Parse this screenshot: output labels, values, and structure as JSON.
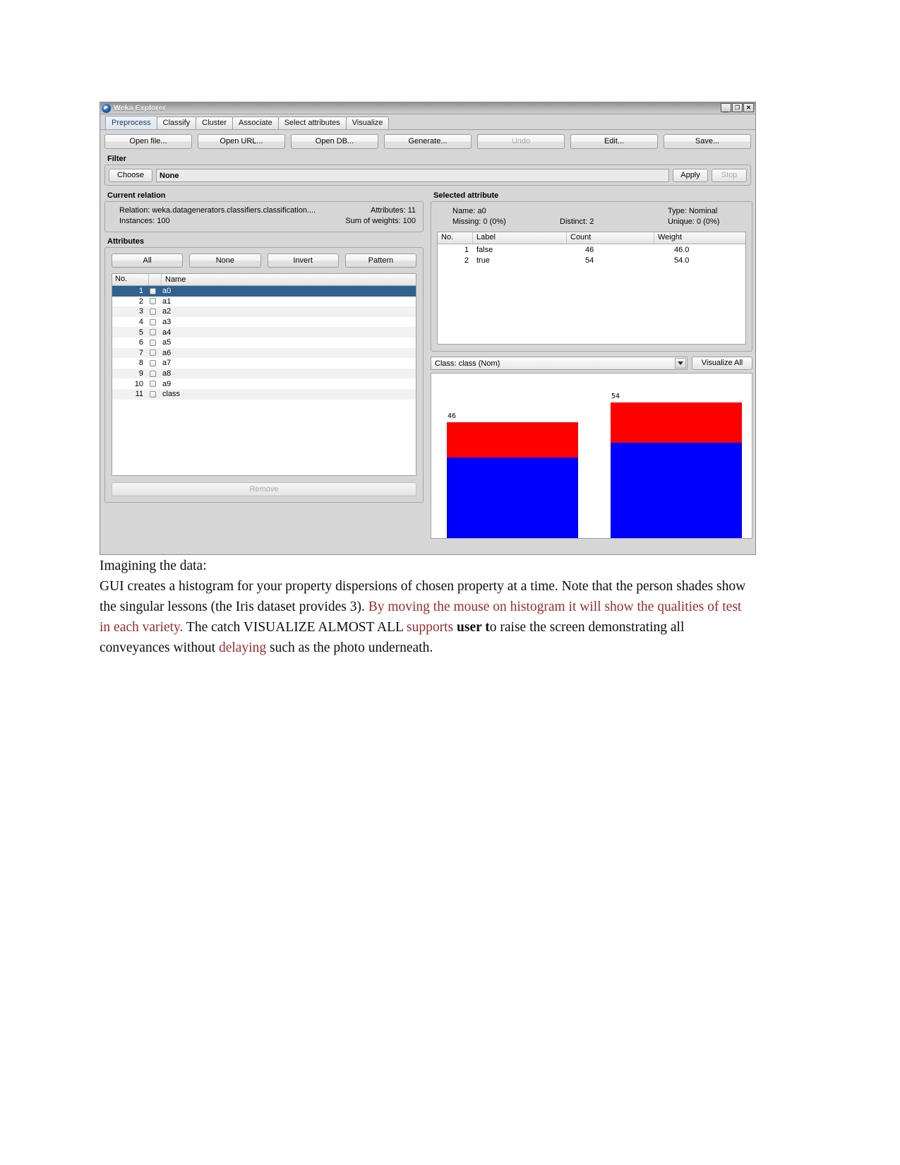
{
  "window": {
    "title": "Weka Explorer",
    "app_icon": "weka-bird-icon",
    "controls": {
      "minimize": "_",
      "maximize": "❐",
      "close": "✕"
    }
  },
  "tabs": [
    {
      "label": "Preprocess",
      "active": true
    },
    {
      "label": "Classify",
      "active": false
    },
    {
      "label": "Cluster",
      "active": false
    },
    {
      "label": "Associate",
      "active": false
    },
    {
      "label": "Select attributes",
      "active": false
    },
    {
      "label": "Visualize",
      "active": false
    }
  ],
  "toolbar": [
    {
      "label": "Open file...",
      "disabled": false
    },
    {
      "label": "Open URL...",
      "disabled": false
    },
    {
      "label": "Open DB...",
      "disabled": false
    },
    {
      "label": "Generate...",
      "disabled": false
    },
    {
      "label": "Undo",
      "disabled": true
    },
    {
      "label": "Edit...",
      "disabled": false
    },
    {
      "label": "Save...",
      "disabled": false
    }
  ],
  "filter": {
    "group_label": "Filter",
    "choose_label": "Choose",
    "value": "None",
    "apply_label": "Apply",
    "stop_label": "Stop",
    "stop_disabled": true
  },
  "current_relation": {
    "group_label": "Current relation",
    "relation_label": "Relation:",
    "relation_value": "weka.datagenerators.classifiers.classification....",
    "attributes_label": "Attributes:",
    "attributes_value": "11",
    "instances_label": "Instances:",
    "instances_value": "100",
    "sum_weights_label": "Sum of weights:",
    "sum_weights_value": "100"
  },
  "attributes": {
    "group_label": "Attributes",
    "buttons": [
      "All",
      "None",
      "Invert",
      "Pattern"
    ],
    "columns": [
      "No.",
      "",
      "Name"
    ],
    "rows": [
      {
        "no": "1",
        "name": "a0",
        "checked": false,
        "selected": true
      },
      {
        "no": "2",
        "name": "a1",
        "checked": false,
        "selected": false
      },
      {
        "no": "3",
        "name": "a2",
        "checked": false,
        "selected": false
      },
      {
        "no": "4",
        "name": "a3",
        "checked": false,
        "selected": false
      },
      {
        "no": "5",
        "name": "a4",
        "checked": false,
        "selected": false
      },
      {
        "no": "6",
        "name": "a5",
        "checked": false,
        "selected": false
      },
      {
        "no": "7",
        "name": "a6",
        "checked": false,
        "selected": false
      },
      {
        "no": "8",
        "name": "a7",
        "checked": false,
        "selected": false
      },
      {
        "no": "9",
        "name": "a8",
        "checked": false,
        "selected": false
      },
      {
        "no": "10",
        "name": "a9",
        "checked": false,
        "selected": false
      },
      {
        "no": "11",
        "name": "class",
        "checked": false,
        "selected": false
      }
    ],
    "remove_label": "Remove",
    "remove_disabled": true
  },
  "selected_attribute": {
    "group_label": "Selected attribute",
    "name_label": "Name:",
    "name_value": "a0",
    "type_label": "Type:",
    "type_value": "Nominal",
    "missing_label": "Missing:",
    "missing_value": "0 (0%)",
    "distinct_label": "Distinct:",
    "distinct_value": "2",
    "unique_label": "Unique:",
    "unique_value": "0 (0%)",
    "columns": [
      "No.",
      "Label",
      "Count",
      "Weight"
    ],
    "rows": [
      {
        "no": "1",
        "label": "false",
        "count": "46",
        "weight": "46.0"
      },
      {
        "no": "2",
        "label": "true",
        "count": "54",
        "weight": "54.0"
      }
    ]
  },
  "class_selector": {
    "value": "Class: class (Nom)",
    "arrow_icon": "chevron-down-icon",
    "visualize_all_label": "Visualize All"
  },
  "chart_data": {
    "type": "bar",
    "title": "",
    "xlabel": "",
    "ylabel": "",
    "stacked": true,
    "categories": [
      "false",
      "true"
    ],
    "values": [
      46,
      54
    ],
    "bar_labels": [
      "46",
      "54"
    ],
    "series": [
      {
        "name": "class-blue",
        "color": "#0000ff",
        "values": [
          32,
          38
        ]
      },
      {
        "name": "class-red",
        "color": "#ff0000",
        "values": [
          14,
          16
        ]
      }
    ],
    "colors": {
      "red": "#ff0000",
      "blue": "#0000ff",
      "background": "#ffffff"
    },
    "legend": "none",
    "grid": false
  },
  "document": {
    "heading": "Imagining the data:",
    "paragraph": [
      {
        "text": "GUI creates a histogram for your property dispersions of chosen property at a time.  Note that the person shades show the singular lessons (the Iris dataset provides 3). ",
        "style": "normal"
      },
      {
        "text": "By moving the mouse on histogram it will show the qualities of test in each variety.",
        "style": "red"
      },
      {
        "text": " The catch VISUALIZE ALMOST ALL ",
        "style": "normal"
      },
      {
        "text": "supports ",
        "style": "red"
      },
      {
        "text": "user t",
        "style": "bold"
      },
      {
        "text": "o raise the screen demonstrating all conveyances without ",
        "style": "normal"
      },
      {
        "text": "delaying",
        "style": "red"
      },
      {
        "text": " such as the photo underneath.",
        "style": "normal"
      }
    ]
  }
}
